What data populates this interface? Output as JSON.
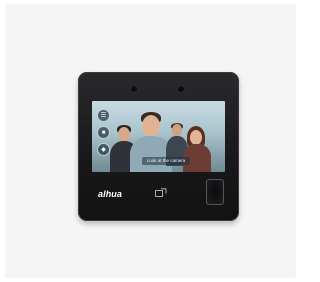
{
  "device": {
    "brand": "alhua",
    "screen_prompt": "Look at the camera",
    "side_buttons": [
      {
        "icon": "menu-icon"
      },
      {
        "icon": "card-icon"
      },
      {
        "icon": "shield-icon"
      }
    ]
  },
  "colors": {
    "page_background": "#f5f5f5",
    "device_body": "#1c1c1e",
    "screen_sky": "#c8dbe2"
  }
}
